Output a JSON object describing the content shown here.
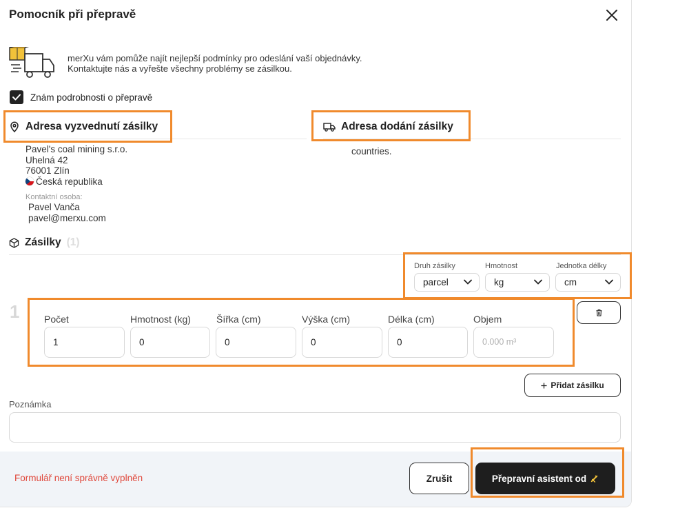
{
  "dialog": {
    "title": "Pomocník při přepravě",
    "close_icon": "close-icon"
  },
  "intro": {
    "line1": "merXu vám pomůže najít nejlepší podmínky pro odeslání vaší objednávky.",
    "line2": "Kontaktujte nás a vyřešte všechny problémy se zásilkou."
  },
  "known_details": {
    "label": "Znám podrobnosti o přepravě",
    "checked": true
  },
  "pickup": {
    "heading": "Adresa vyzvednutí zásilky",
    "icon": "map-pin-icon",
    "company": "Pavel's coal mining s.r.o.",
    "street": "Uhelná 42",
    "city": "76001 Zlín",
    "country": "Česká republika",
    "contact_label": "Kontaktní osoba:",
    "contact_name": "Pavel Vanča",
    "contact_email": "pavel@merxu.com"
  },
  "delivery": {
    "heading": "Adresa dodání zásilky",
    "icon": "truck-icon",
    "text": "countries."
  },
  "shipments": {
    "heading": "Zásilky",
    "count": "(1)",
    "type_label": "Druh zásilky",
    "type_value": "parcel",
    "weight_label": "Hmotnost",
    "weight_value": "kg",
    "length_label": "Jednotka délky",
    "length_value": "cm",
    "rows": [
      {
        "number": "1",
        "fields": [
          {
            "label": "Počet",
            "value": "1"
          },
          {
            "label": "Hmotnost (kg)",
            "value": "0"
          },
          {
            "label": "Šířka (cm)",
            "value": "0"
          },
          {
            "label": "Výška (cm)",
            "value": "0"
          },
          {
            "label": "Délka (cm)",
            "value": "0"
          },
          {
            "label": "Objem",
            "value": "0.000 m³"
          }
        ]
      }
    ],
    "add_label": "Přidat zásilku"
  },
  "note": {
    "label": "Poznámka",
    "value": ""
  },
  "footer": {
    "error": "Formulář není správně vyplněn",
    "cancel_label": "Zrušit",
    "submit_label": "Přepravní asistent od"
  },
  "colors": {
    "highlight": "#f08a2c",
    "error": "#e0483c",
    "primary": "#1e1e1e",
    "footer_bg": "#f1f4f8"
  }
}
